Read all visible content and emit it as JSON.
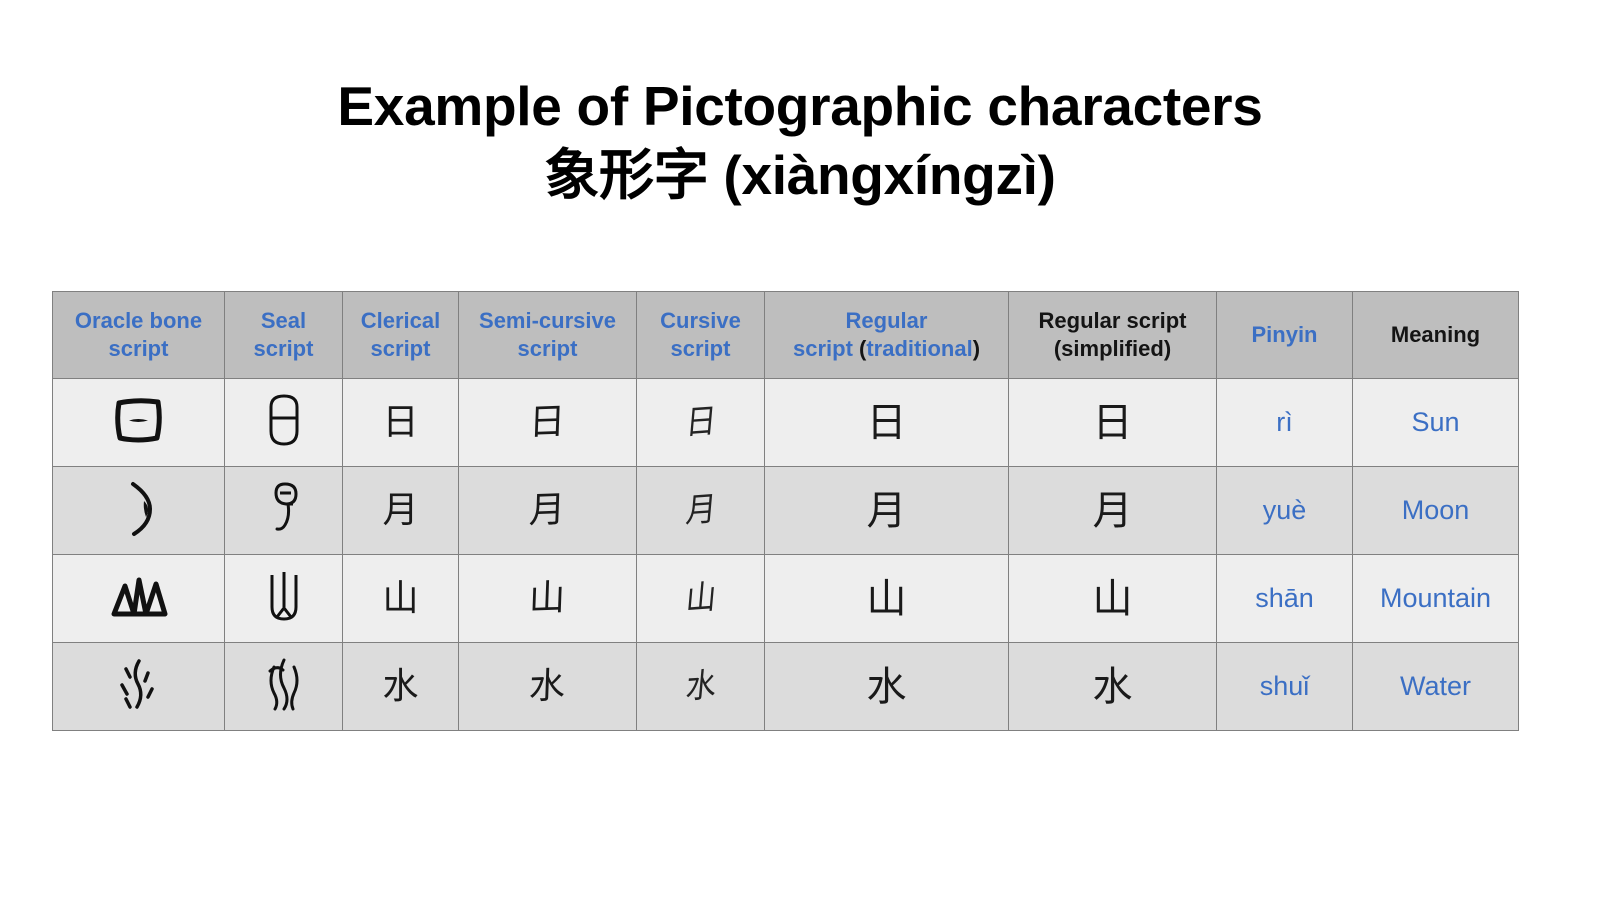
{
  "slide": {
    "background_color": "#ffffff",
    "title_line1": "Example of Pictographic characters",
    "title_line2": "象形字 (xiàngxíngzì)"
  },
  "colors": {
    "accent_blue": "#3b6fc4",
    "header_bg": "#bebebe",
    "row_odd_bg": "#eeeeee",
    "row_even_bg": "#dcdcdc",
    "border": "#808080",
    "text_black": "#141414"
  },
  "table": {
    "headers": [
      {
        "id": "oracle-bone-script",
        "line1": "Oracle bone",
        "line2": "script",
        "line1_color": "blue",
        "line2_color": "blue"
      },
      {
        "id": "seal-script",
        "line1": "Seal",
        "line2": "script",
        "line1_color": "blue",
        "line2_color": "blue"
      },
      {
        "id": "clerical-script",
        "line1": "Clerical",
        "line2": "script",
        "line1_color": "blue",
        "line2_color": "blue"
      },
      {
        "id": "semi-cursive-script",
        "line1": "Semi-cursive",
        "line2": "script",
        "line1_color": "blue",
        "line2_color": "blue"
      },
      {
        "id": "cursive-script",
        "line1": "Cursive",
        "line2": "script",
        "line1_color": "blue",
        "line2_color": "blue"
      },
      {
        "id": "regular-script-traditional",
        "line1": "Regular",
        "line2_a": "script ",
        "line2_b": "(",
        "line2_c": "traditional",
        "line2_d": ")",
        "line1_color": "blue",
        "line2_color": "mixed"
      },
      {
        "id": "regular-script-simplified",
        "line1": "Regular script",
        "line2": "(simplified)",
        "line1_color": "black",
        "line2_color": "black"
      },
      {
        "id": "pinyin",
        "line1": "Pinyin",
        "line2": "",
        "line1_color": "blue",
        "line2_color": "blue"
      },
      {
        "id": "meaning",
        "line1": "Meaning",
        "line2": "",
        "line1_color": "black",
        "line2_color": "black"
      }
    ],
    "rows": [
      {
        "id": "row-sun",
        "oracle_bone": "sun-oracle-glyph",
        "seal": "sun-seal-glyph",
        "clerical": "日",
        "semi_cursive": "日",
        "cursive": "日",
        "regular_traditional": "日",
        "regular_simplified": "日",
        "pinyin": "rì",
        "meaning": "Sun"
      },
      {
        "id": "row-moon",
        "oracle_bone": "moon-oracle-glyph",
        "seal": "moon-seal-glyph",
        "clerical": "月",
        "semi_cursive": "月",
        "cursive": "月",
        "regular_traditional": "月",
        "regular_simplified": "月",
        "pinyin": "yuè",
        "meaning": "Moon"
      },
      {
        "id": "row-mountain",
        "oracle_bone": "mountain-oracle-glyph",
        "seal": "mountain-seal-glyph",
        "clerical": "山",
        "semi_cursive": "山",
        "cursive": "山",
        "regular_traditional": "山",
        "regular_simplified": "山",
        "pinyin": "shān",
        "meaning": "Mountain"
      },
      {
        "id": "row-water",
        "oracle_bone": "water-oracle-glyph",
        "seal": "water-seal-glyph",
        "clerical": "水",
        "semi_cursive": "水",
        "cursive": "水",
        "regular_traditional": "水",
        "regular_simplified": "水",
        "pinyin": "shuǐ",
        "meaning": "Water"
      }
    ]
  }
}
